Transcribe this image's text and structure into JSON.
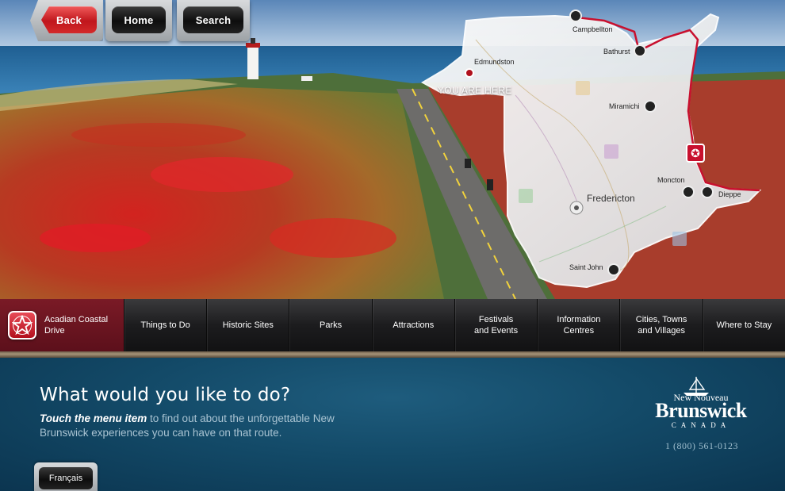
{
  "nav": {
    "back_label": "Back",
    "home_label": "Home",
    "search_label": "Search"
  },
  "map": {
    "you_are_here": "YOU ARE HERE",
    "cities": {
      "edmundston": "Edmundston",
      "campbellton": "Campbellton",
      "bathurst": "Bathurst",
      "miramichi": "Miramichi",
      "fredericton": "Fredericton",
      "moncton": "Moncton",
      "dieppe": "Dieppe",
      "saint_john": "Saint John"
    },
    "route_color": "#c8102e"
  },
  "menu": {
    "active_label": "Acadian Coastal Drive",
    "items": [
      "Things to Do",
      "Historic Sites",
      "Parks",
      "Attractions",
      "Festivals and Events",
      "Information Centres",
      "Cities, Towns and Villages",
      "Where to Stay"
    ]
  },
  "content": {
    "question": "What would you like to do?",
    "instruction_bold": "Touch the menu item",
    "instruction_rest": "to find out about the unforgettable New Brunswick experiences you can have on that route."
  },
  "brand": {
    "line1": "New Nouveau",
    "name": "Brunswick",
    "country": "CANADA",
    "phone": "1 (800) 561-0123"
  },
  "language_button": "Français"
}
